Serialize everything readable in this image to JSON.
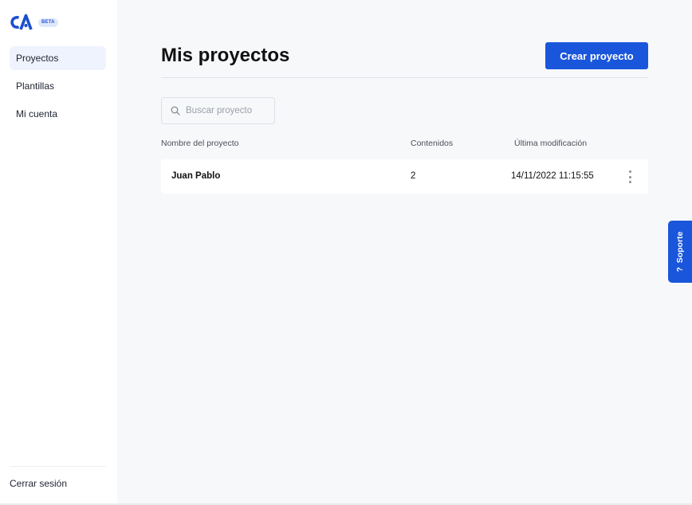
{
  "brand": {
    "logo_text": "CA",
    "beta_label": "BETA",
    "accent_color": "#1a56db"
  },
  "sidebar": {
    "items": [
      {
        "label": "Proyectos",
        "active": true
      },
      {
        "label": "Plantillas",
        "active": false
      },
      {
        "label": "Mi cuenta",
        "active": false
      }
    ],
    "logout_label": "Cerrar sesión"
  },
  "header": {
    "title": "Mis proyectos",
    "create_label": "Crear proyecto"
  },
  "search": {
    "placeholder": "Buscar proyecto",
    "value": "",
    "icon": "search-icon"
  },
  "table": {
    "columns": [
      "Nombre del proyecto",
      "Contenidos",
      "Última modificación"
    ],
    "rows": [
      {
        "name": "Juan Pablo",
        "count": "2",
        "modified": "14/11/2022 11:15:55"
      }
    ]
  },
  "support": {
    "label": "Soporte",
    "icon_glyph": "?"
  }
}
